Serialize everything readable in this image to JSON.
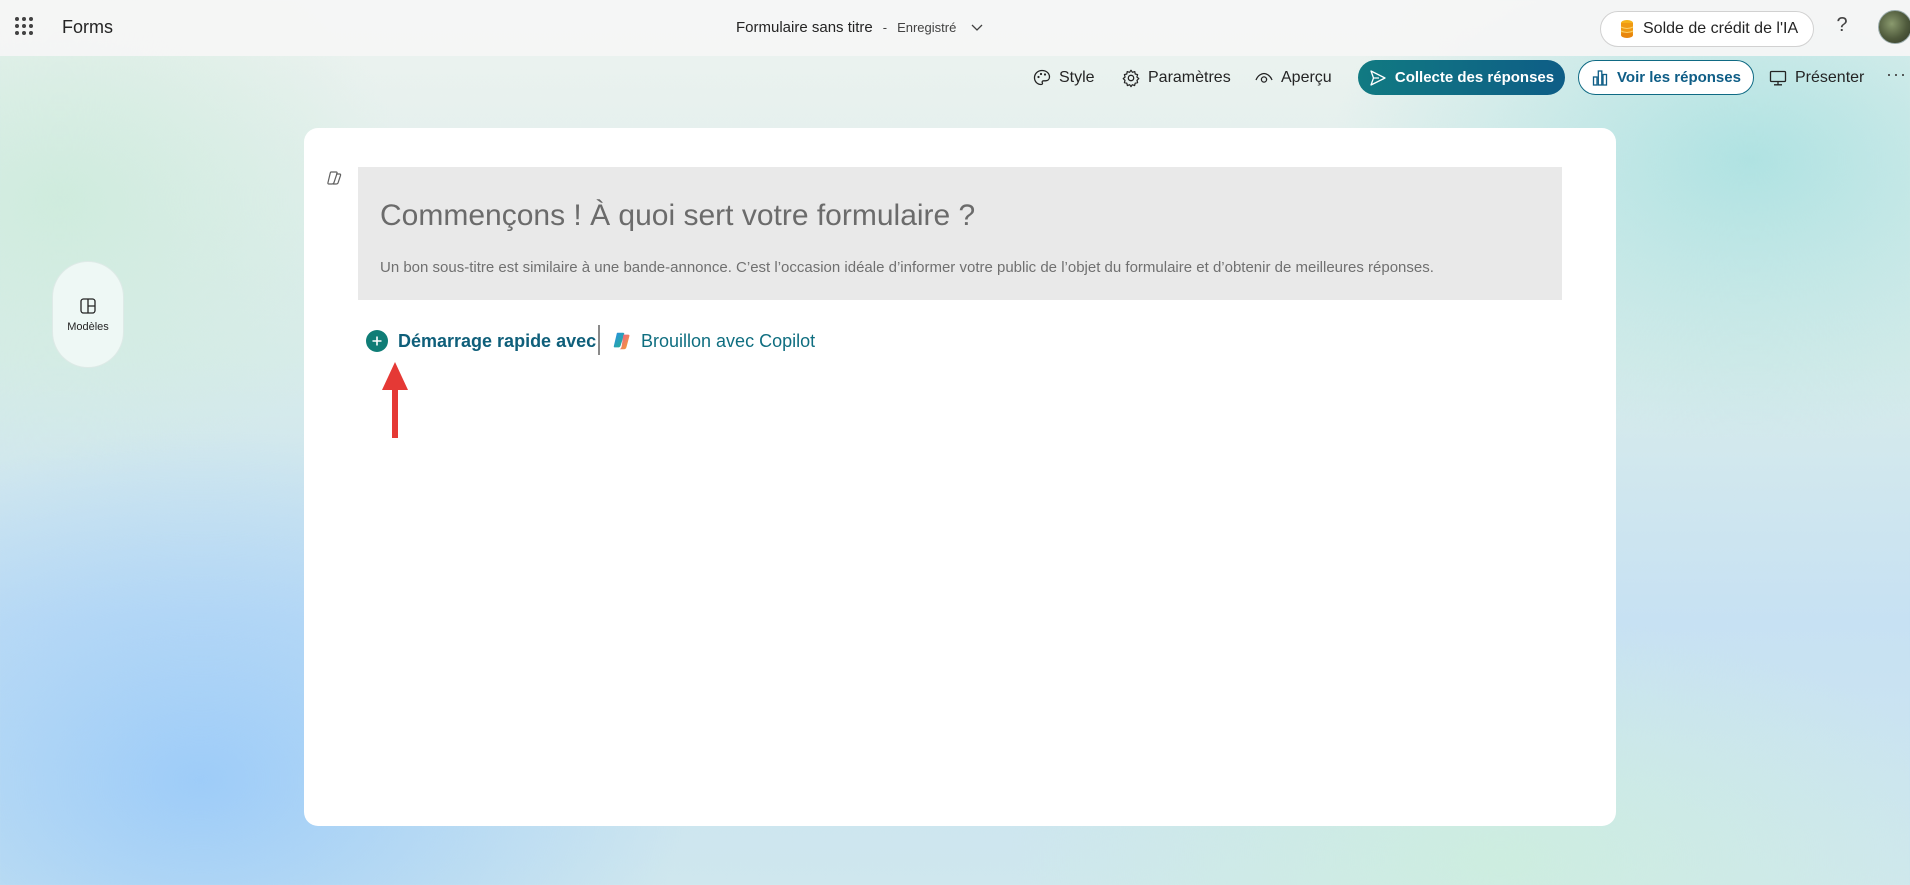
{
  "header": {
    "app_name": "Forms",
    "doc_title": "Formulaire sans titre",
    "doc_separator": "-",
    "doc_status": "Enregistré",
    "ai_credit_label": "Solde de crédit de l'IA",
    "help_label": "?"
  },
  "toolbar": {
    "style_label": "Style",
    "settings_label": "Paramètres",
    "preview_label": "Aperçu",
    "collect_label": "Collecte des réponses",
    "view_responses_label": "Voir les réponses",
    "present_label": "Présenter",
    "more_label": "···"
  },
  "sidebar": {
    "templates_label": "Modèles"
  },
  "form": {
    "title_placeholder": "Commençons ! À quoi sert votre formulaire ?",
    "subtitle_placeholder": "Un bon sous-titre est similaire à une bande-annonce. C’est l’occasion idéale d’informer votre public de l’objet du formulaire et d’obtenir de meilleures réponses.",
    "quick_start_label": "Démarrage rapide avec",
    "copilot_draft_label": "Brouillon avec Copilot"
  },
  "colors": {
    "primary": "#117a82",
    "primary_end": "#0e5d86",
    "annotation_arrow": "#e53935"
  },
  "icons": {
    "app_launcher": "waffle-icon",
    "credit": "coin-stack-icon",
    "style": "palette-icon",
    "settings": "gear-icon",
    "preview": "eye-icon",
    "collect": "send-icon",
    "view_responses": "bar-chart-icon",
    "present": "monitor-icon",
    "templates": "layout-icon",
    "copilot": "copilot-icon",
    "quick_start": "plus-circle-icon"
  }
}
